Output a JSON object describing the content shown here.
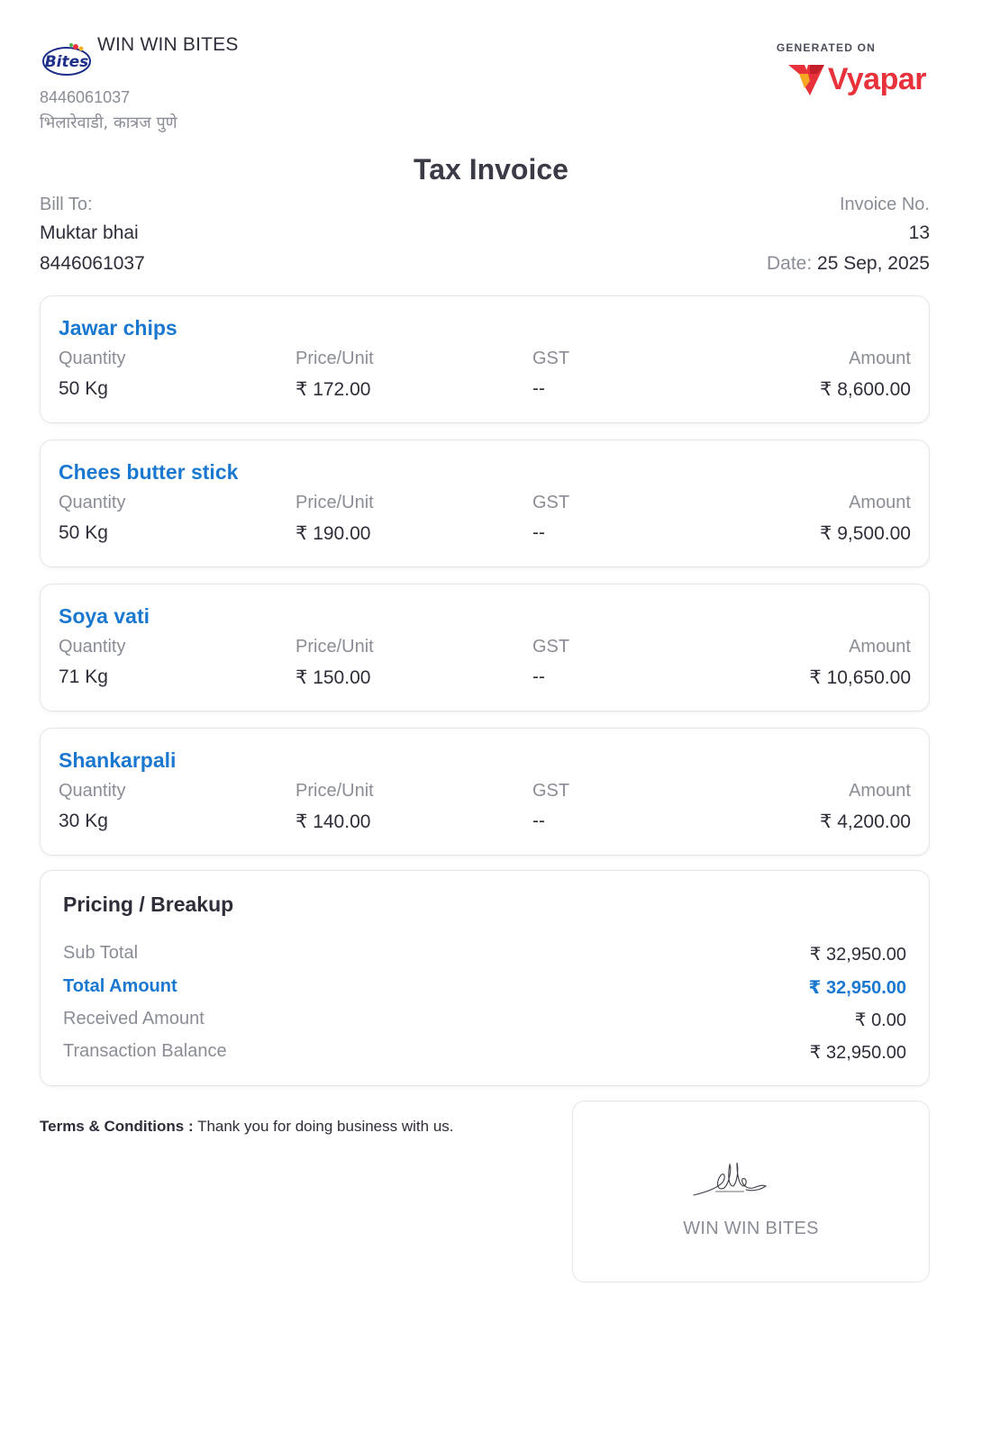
{
  "business": {
    "name": "WIN WIN BITES",
    "logo_text": "Bites",
    "phone": "8446061037",
    "address": "भिलारेवाडी, कात्रज पुणे"
  },
  "generator": {
    "label": "GENERATED ON",
    "brand": "Vyapar",
    "brand_color": "#e8323b"
  },
  "title": "Tax Invoice",
  "bill_to": {
    "label": "Bill To:",
    "name": "Muktar bhai",
    "phone": "8446061037"
  },
  "invoice": {
    "no_label": "Invoice No.",
    "number": "13",
    "date_label": "Date:",
    "date": "25 Sep, 2025"
  },
  "column_headers": {
    "quantity": "Quantity",
    "price": "Price/Unit",
    "gst": "GST",
    "amount": "Amount"
  },
  "items": [
    {
      "name": "Jawar chips",
      "quantity": "50 Kg",
      "price": "₹ 172.00",
      "gst": "--",
      "amount": "₹ 8,600.00"
    },
    {
      "name": "Chees butter stick",
      "quantity": "50 Kg",
      "price": "₹ 190.00",
      "gst": "--",
      "amount": "₹ 9,500.00"
    },
    {
      "name": "Soya vati",
      "quantity": "71 Kg",
      "price": "₹ 150.00",
      "gst": "--",
      "amount": "₹ 10,650.00"
    },
    {
      "name": "Shankarpali",
      "quantity": "30 Kg",
      "price": "₹ 140.00",
      "gst": "--",
      "amount": "₹ 4,200.00"
    }
  ],
  "breakup": {
    "title": "Pricing / Breakup",
    "sub_total_label": "Sub Total",
    "sub_total": "₹ 32,950.00",
    "total_label": "Total Amount",
    "total": "₹ 32,950.00",
    "received_label": "Received Amount",
    "received": "₹ 0.00",
    "balance_label": "Transaction Balance",
    "balance": "₹ 32,950.00"
  },
  "terms": {
    "label": "Terms & Conditions :",
    "text": "Thank you for doing business with us."
  },
  "signature": {
    "name": "WIN WIN BITES"
  },
  "colors": {
    "accent": "#1b78d0",
    "muted": "#8a8d96",
    "text": "#2e2e3a"
  }
}
